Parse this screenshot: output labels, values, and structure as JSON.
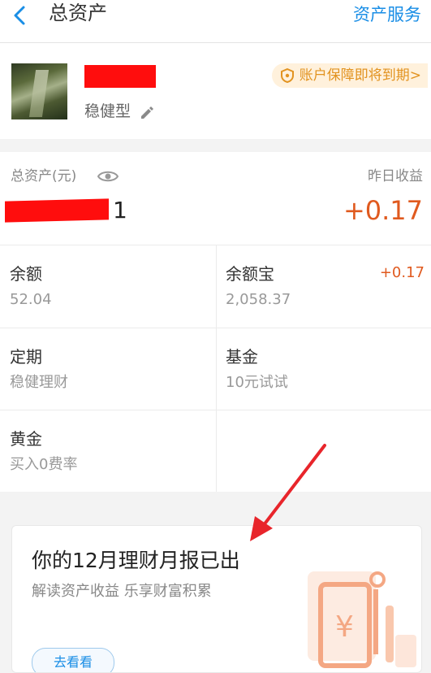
{
  "header": {
    "title": "总资产",
    "action": "资产服务",
    "accent_color": "#1a8ee6"
  },
  "profile": {
    "risk_type": "稳健型",
    "guarantee_notice": "账户保障即将到期>"
  },
  "assets": {
    "total_label": "总资产(元)",
    "total_value_visible": "1",
    "yesterday_label": "昨日收益",
    "yesterday_value": "+0.17"
  },
  "grid": [
    {
      "title": "余额",
      "sub": "52.04",
      "badge": ""
    },
    {
      "title": "余额宝",
      "sub": "2,058.37",
      "badge": "+0.17"
    },
    {
      "title": "定期",
      "sub": "稳健理财",
      "badge": ""
    },
    {
      "title": "基金",
      "sub": "10元试试",
      "badge": ""
    },
    {
      "title": "黄金",
      "sub": "买入0费率",
      "badge": ""
    }
  ],
  "report": {
    "title": "你的12月理财月报已出",
    "subtitle": "解读资产收益 乐享财富积累",
    "button_label": "去看看"
  },
  "colors": {
    "income": "#e05a1f",
    "badge_bg": "#fff1dc",
    "badge_text": "#e29320",
    "redaction": "#ff0d0d",
    "arrow": "#e8252b"
  },
  "icons": [
    "back-icon",
    "edit-icon",
    "shield-icon",
    "eye-icon",
    "money-bag-icon",
    "arrow-annotation-icon"
  ]
}
